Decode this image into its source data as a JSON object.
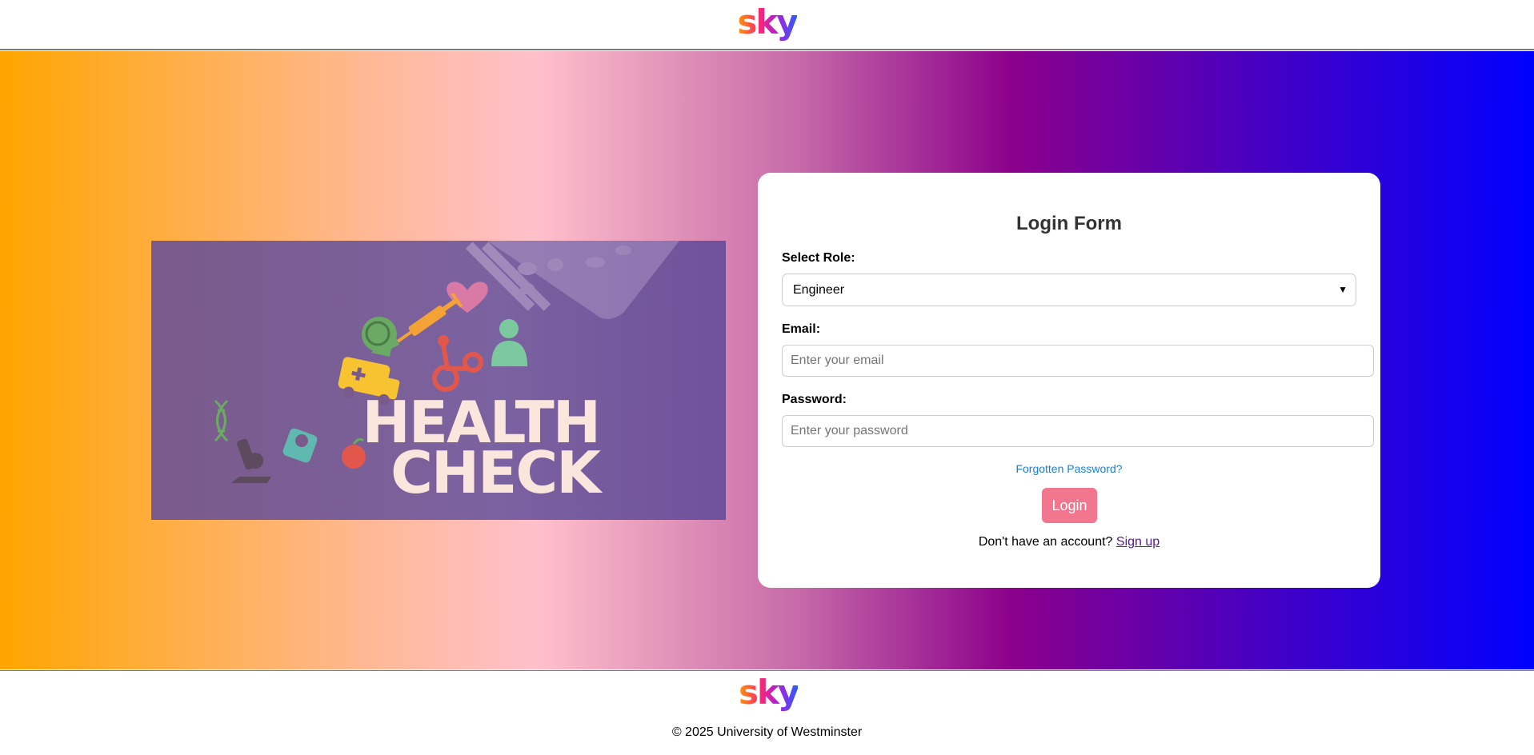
{
  "header": {
    "logo_text": "sky"
  },
  "banner": {
    "title_line1": "HEALTH",
    "title_line2": "CHECK"
  },
  "login": {
    "title": "Login Form",
    "role_label": "Select Role:",
    "role_value": "Engineer",
    "email_label": "Email:",
    "email_placeholder": "Enter your email",
    "password_label": "Password:",
    "password_placeholder": "Enter your password",
    "forgot_link": "Forgotten Password?",
    "login_button": "Login",
    "signup_prompt": "Don't have an account?",
    "signup_link": "Sign up"
  },
  "footer": {
    "logo_text": "sky",
    "copyright": "© 2025 University of Westminster"
  },
  "colors": {
    "accent": "#f1768e",
    "link": "#1a7fd4",
    "visited_link": "#551a8b"
  },
  "icons": [
    "dna-icon",
    "microscope-icon",
    "scale-icon",
    "apple-icon",
    "ambulance-icon",
    "brain-icon",
    "syringe-icon",
    "wheelchair-icon",
    "person-icon",
    "heart-icon",
    "pill-bottle-icon"
  ]
}
